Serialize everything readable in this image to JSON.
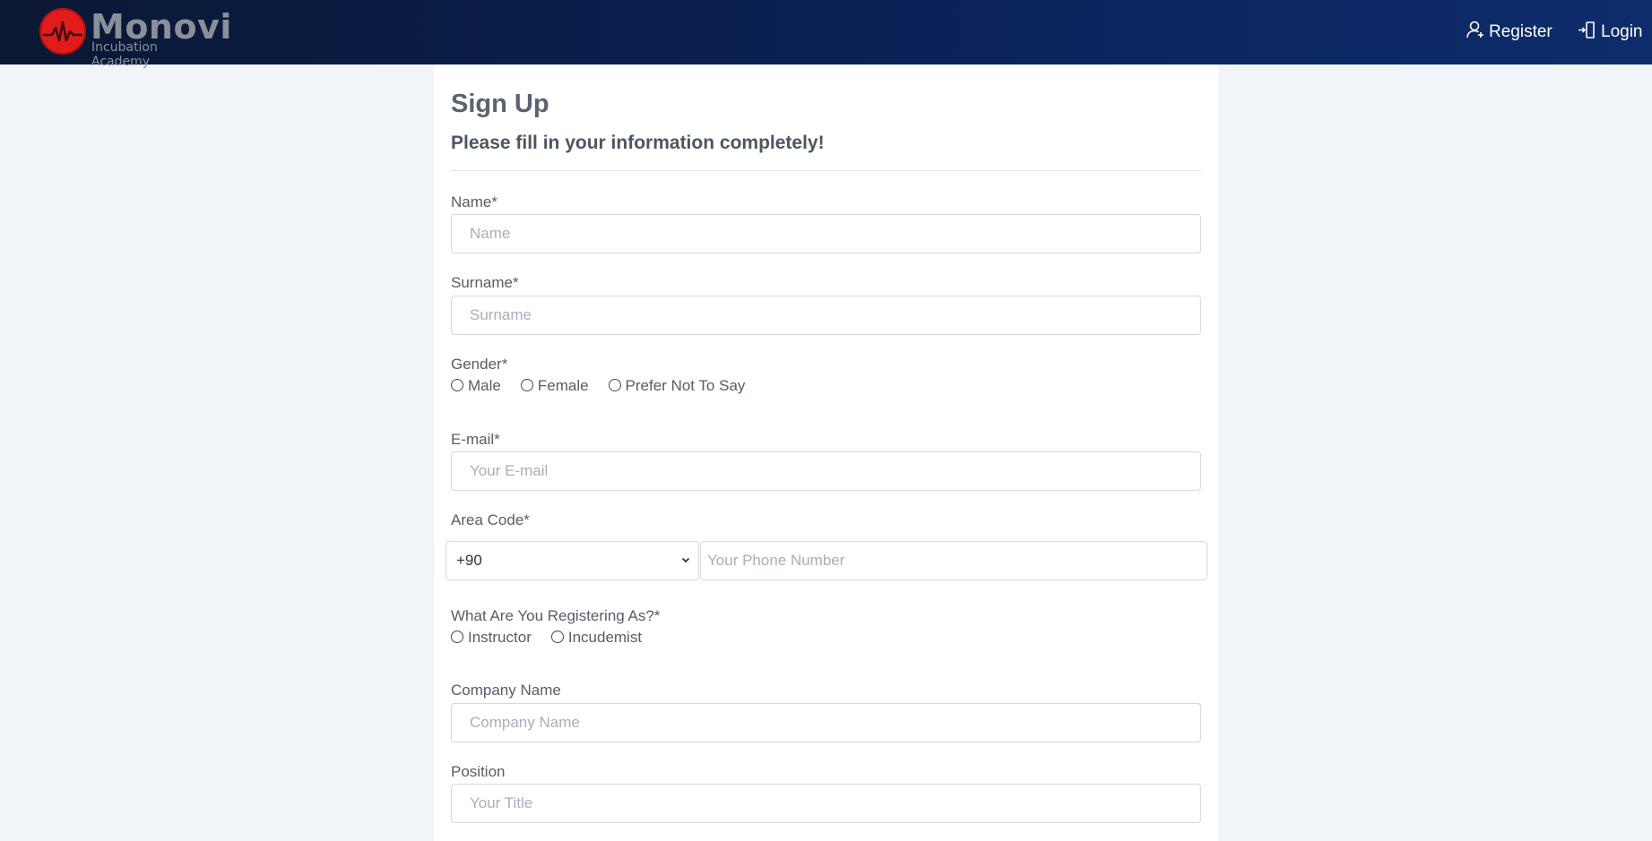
{
  "header": {
    "logo_word": "Monovi",
    "logo_sub": "Incubation Academy",
    "register_label": "Register",
    "login_label": "Login"
  },
  "form": {
    "title": "Sign Up",
    "subtitle": "Please fill in your information completely!",
    "name": {
      "label": "Name*",
      "placeholder": "Name"
    },
    "surname": {
      "label": "Surname*",
      "placeholder": "Surname"
    },
    "gender": {
      "label": "Gender*",
      "options": [
        "Male",
        "Female",
        "Prefer Not To Say"
      ]
    },
    "email": {
      "label": "E-mail*",
      "placeholder": "Your E-mail"
    },
    "area_code": {
      "label": "Area Code*",
      "selected": "+90",
      "phone_placeholder": "Your Phone Number"
    },
    "registering_as": {
      "label": "What Are You Registering As?*",
      "options": [
        "Instructor",
        "Incudemist"
      ]
    },
    "company": {
      "label": "Company Name",
      "placeholder": "Company Name"
    },
    "position": {
      "label": "Position",
      "placeholder": "Your Title"
    }
  },
  "colors": {
    "header_start": "#0a1833",
    "header_end": "#0d2c6b",
    "logo_red": "#e31b1b",
    "page_bg": "#f1f4f9"
  },
  "icons": {
    "register": "user-plus-icon",
    "login": "login-door-icon",
    "select": "chevron-down-icon"
  }
}
